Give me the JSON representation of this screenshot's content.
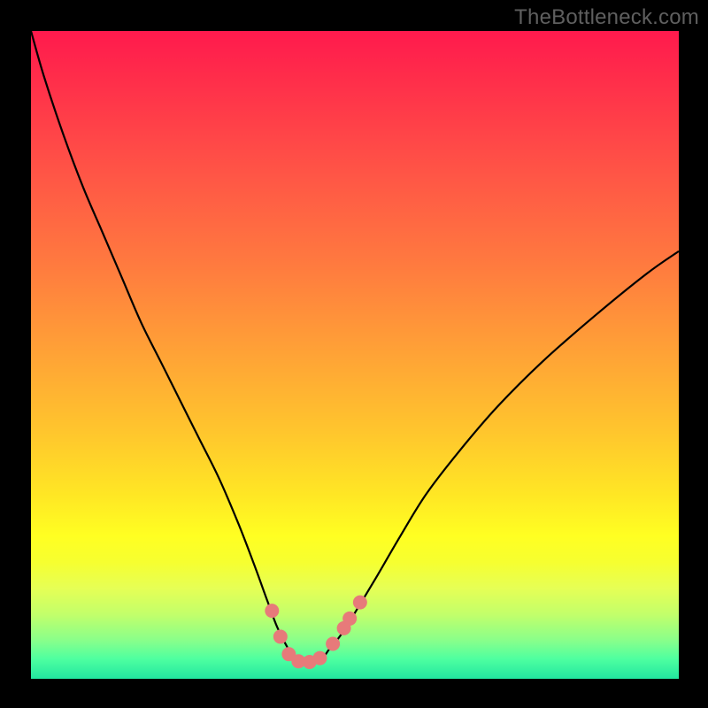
{
  "watermark": "TheBottleneck.com",
  "chart_data": {
    "type": "line",
    "title": "",
    "xlabel": "",
    "ylabel": "",
    "xlim": [
      0,
      100
    ],
    "ylim": [
      0,
      100
    ],
    "series": [
      {
        "name": "curve",
        "x": [
          0,
          2,
          5,
          8,
          11,
          14,
          17,
          20,
          23,
          26,
          29,
          32,
          34.5,
          36.5,
          38,
          39.5,
          40.7,
          44.5,
          46,
          48,
          50.5,
          53.5,
          57,
          61,
          66,
          72,
          79,
          87,
          95,
          100
        ],
        "y": [
          100,
          93,
          84,
          76,
          69,
          62,
          55,
          49,
          43,
          37,
          31,
          24,
          17.5,
          12,
          8,
          5,
          3,
          3,
          4.5,
          7,
          11,
          16,
          22,
          28.5,
          35,
          42,
          49,
          56,
          62.5,
          66
        ]
      }
    ],
    "markers": [
      {
        "name": "dots",
        "color": "#e77a7a",
        "radius_px": 8,
        "points": [
          {
            "x": 37.2,
            "y": 10.5
          },
          {
            "x": 38.5,
            "y": 6.5
          },
          {
            "x": 39.8,
            "y": 3.8
          },
          {
            "x": 41.3,
            "y": 2.7
          },
          {
            "x": 43.0,
            "y": 2.6
          },
          {
            "x": 44.6,
            "y": 3.2
          },
          {
            "x": 46.6,
            "y": 5.4
          },
          {
            "x": 48.3,
            "y": 7.8
          },
          {
            "x": 49.2,
            "y": 9.3
          },
          {
            "x": 50.8,
            "y": 11.8
          }
        ]
      }
    ]
  }
}
